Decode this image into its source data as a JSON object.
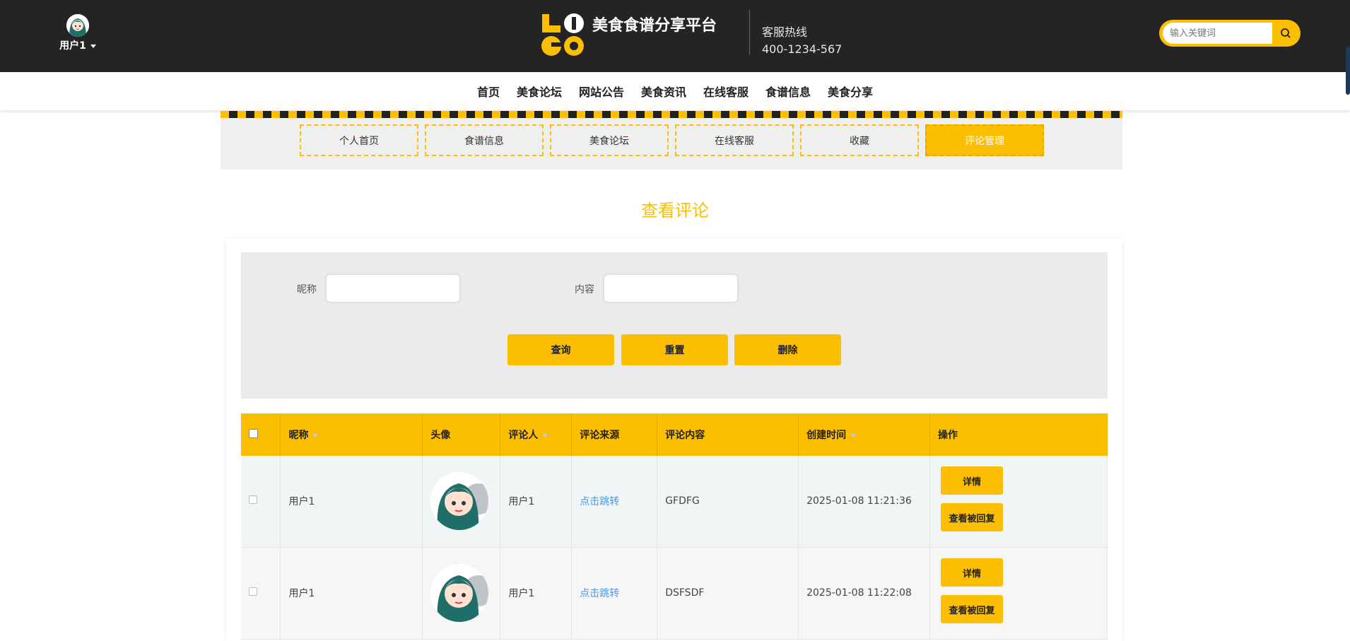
{
  "header": {
    "user_name": "用户1",
    "logo_letters": [
      "L",
      "I",
      "G",
      "O"
    ],
    "site_title": "美食食谱分享平台",
    "hotline_label": "客服热线",
    "hotline_number": "400-1234-567",
    "search_placeholder": "输入关键词"
  },
  "nav": [
    "首页",
    "美食论坛",
    "网站公告",
    "美食资讯",
    "在线客服",
    "食谱信息",
    "美食分享"
  ],
  "sub_tabs": [
    "个人首页",
    "食谱信息",
    "美食论坛",
    "在线客服",
    "收藏",
    "评论管理"
  ],
  "active_tab": "评论管理",
  "page_title": "查看评论",
  "filters": {
    "nickname_label": "昵称",
    "nickname_value": "",
    "content_label": "内容",
    "content_value": ""
  },
  "buttons": {
    "query": "查询",
    "reset": "重置",
    "delete": "删除"
  },
  "table": {
    "headers": [
      "昵称",
      "头像",
      "评论人",
      "评论来源",
      "评论内容",
      "创建时间",
      "操作"
    ],
    "rows": [
      {
        "nickname": "用户1",
        "commenter": "用户1",
        "source": "点击跳转",
        "content": "GFDFG",
        "created": "2025-01-08 11:21:36"
      },
      {
        "nickname": "用户1",
        "commenter": "用户1",
        "source": "点击跳转",
        "content": "DSFSDF",
        "created": "2025-01-08 11:22:08"
      }
    ],
    "detail_label": "详情",
    "view_reply_label": "查看被回复"
  },
  "colors": {
    "accent": "#fcbe00",
    "topbar": "#242424",
    "link": "#4a9ae0"
  }
}
